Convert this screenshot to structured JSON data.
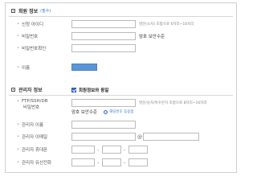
{
  "member_section": {
    "title": "회원 정보",
    "note": "(필수)",
    "fields": {
      "login_id": {
        "label": "신청 아이디",
        "hint": "영문(소자) 조합으로 6자리~16자리"
      },
      "password": {
        "label": "비밀번호",
        "hint": "암호 보안수준"
      },
      "password_confirm": {
        "label": "비밀번호확인"
      },
      "name": {
        "label": "이름"
      }
    }
  },
  "admin_section": {
    "title": "관리자 정보",
    "same_as_member_label": "회원정보와 동일",
    "same_as_member_checked": true,
    "fields": {
      "ftp_password": {
        "label_line1": "FTP/SSH/DB",
        "label_line2": "비밀번호",
        "hint": "영문/숫자/특수문자 조합으로 8자리~16자리",
        "security_label": "암호 보안수준",
        "radio_label": "해당번호 동용함"
      },
      "admin_name": {
        "label": "관리자 이름"
      },
      "admin_email": {
        "label": "관리자 이메일",
        "at_sign": "@"
      },
      "admin_mobile": {
        "label": "관리자 휴대폰",
        "dash": "-"
      },
      "admin_phone": {
        "label": "관리자 유선전화",
        "dash": "-"
      }
    }
  },
  "colors": {
    "accent": "#3a6fc4",
    "name_fill": "#5b95d8"
  }
}
